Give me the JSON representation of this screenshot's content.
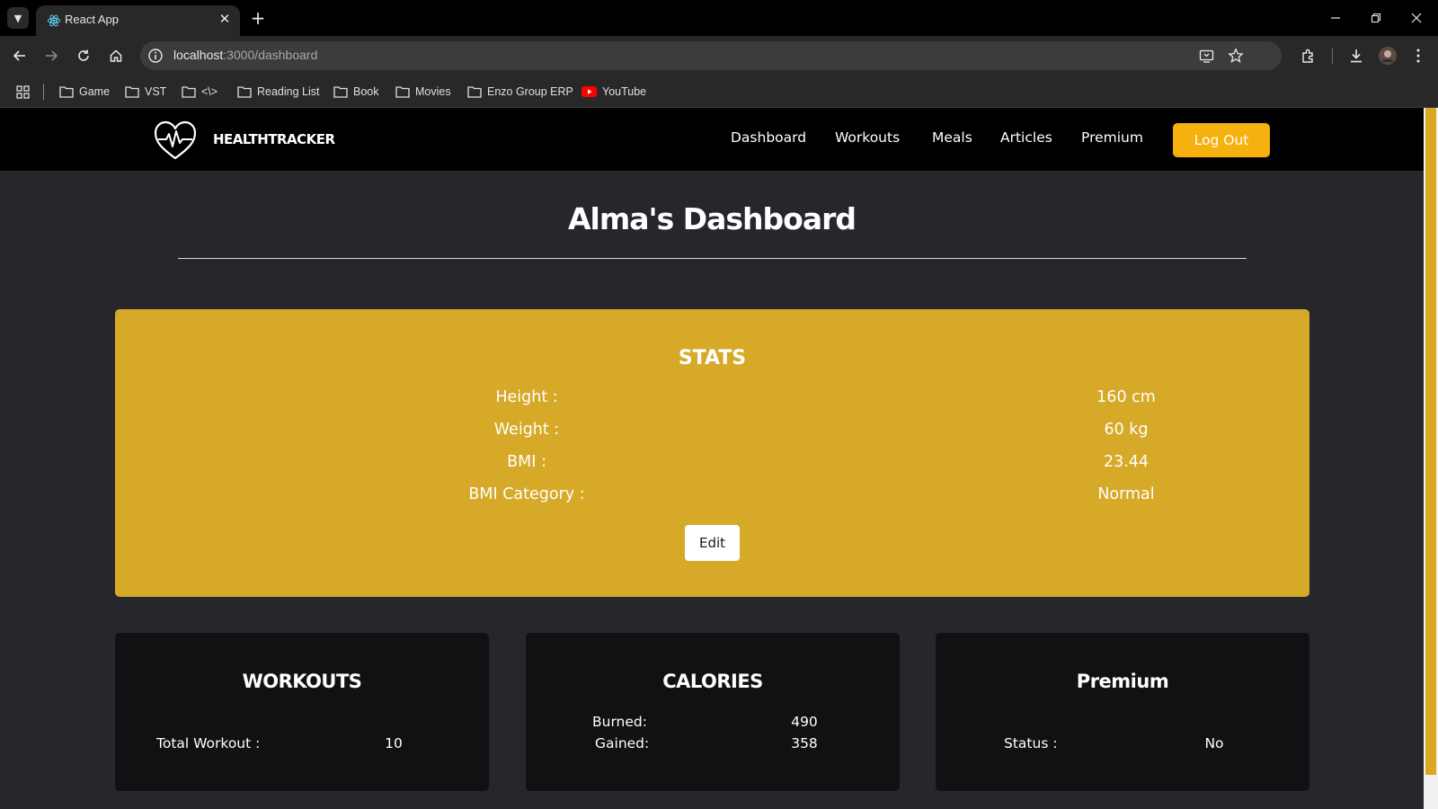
{
  "browser": {
    "tab_title": "React App",
    "url_host": "localhost",
    "url_path": ":3000/dashboard",
    "bookmarks": [
      "Game",
      "VST",
      "<\\>",
      "Reading List",
      "Book",
      "Movies",
      "Enzo Group ERP",
      "YouTube"
    ]
  },
  "site": {
    "brand": "HEALTHTRACKER",
    "nav": [
      "Dashboard",
      "Workouts",
      "Meals",
      "Articles",
      "Premium"
    ],
    "logout_label": "Log Out",
    "accent_color": "#f6b10f"
  },
  "dashboard": {
    "title": "Alma's Dashboard",
    "stats": {
      "heading": "STATS",
      "rows": [
        {
          "label": "Height :",
          "value": "160 cm"
        },
        {
          "label": "Weight :",
          "value": "60 kg"
        },
        {
          "label": "BMI :",
          "value": "23.44"
        },
        {
          "label": "BMI Category :",
          "value": "Normal"
        }
      ],
      "edit_label": "Edit"
    },
    "workouts": {
      "heading": "WORKOUTS",
      "label": "Total Workout :",
      "value": "10"
    },
    "calories": {
      "heading": "CALORIES",
      "burned_label": "Burned:",
      "burned_value": "490",
      "gained_label": "Gained:",
      "gained_value": "358"
    },
    "premium": {
      "heading": "Premium",
      "label": "Status :",
      "value": "No"
    }
  }
}
